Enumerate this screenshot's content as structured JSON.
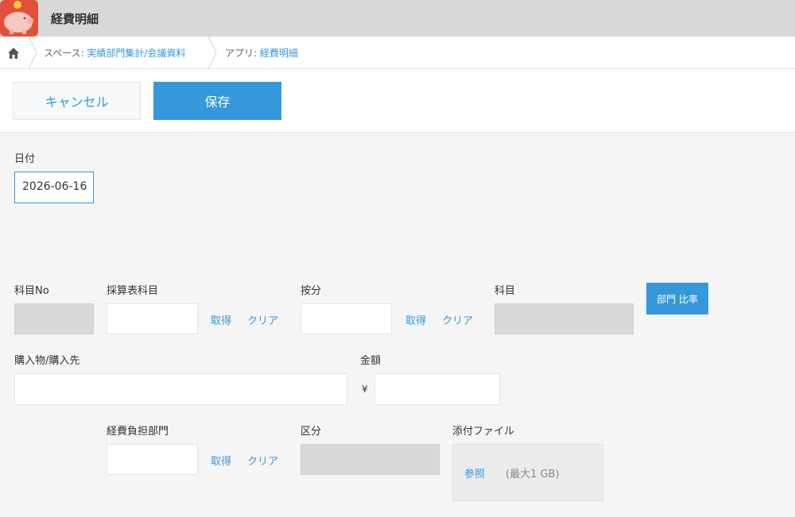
{
  "header": {
    "app_title": "経費明細",
    "app_icon": "piggy-bank-icon"
  },
  "breadcrumb": {
    "home_icon": "home-icon",
    "space_prefix": "スペース: ",
    "space_name": "実績部門集計/会議資料",
    "app_prefix": "アプリ: ",
    "app_name": "経費明細"
  },
  "toolbar": {
    "cancel_label": "キャンセル",
    "save_label": "保存"
  },
  "form": {
    "date": {
      "label": "日付",
      "value": "2026-06-16"
    },
    "account_no": {
      "label": "科目No",
      "value": ""
    },
    "budget_account": {
      "label": "採算表科目",
      "value": "",
      "fetch_label": "取得",
      "clear_label": "クリア"
    },
    "allocation": {
      "label": "按分",
      "value": "",
      "fetch_label": "取得",
      "clear_label": "クリア"
    },
    "account": {
      "label": "科目",
      "value": ""
    },
    "dept_ratio_button": "部門 比率",
    "purchase": {
      "label": "購入物/購入先",
      "value": ""
    },
    "amount": {
      "label": "金額",
      "currency": "¥",
      "value": ""
    },
    "cost_dept": {
      "label": "経費負担部門",
      "value": "",
      "fetch_label": "取得",
      "clear_label": "クリア"
    },
    "category": {
      "label": "区分",
      "value": ""
    },
    "attachment": {
      "label": "添付ファイル",
      "browse_label": "参照",
      "limit_note": "(最大1 GB)"
    }
  },
  "colors": {
    "accent": "#3498db",
    "header_bg": "#d8d8d8",
    "app_icon_bg": "#e2503b",
    "form_bg": "#f5f5f5"
  }
}
